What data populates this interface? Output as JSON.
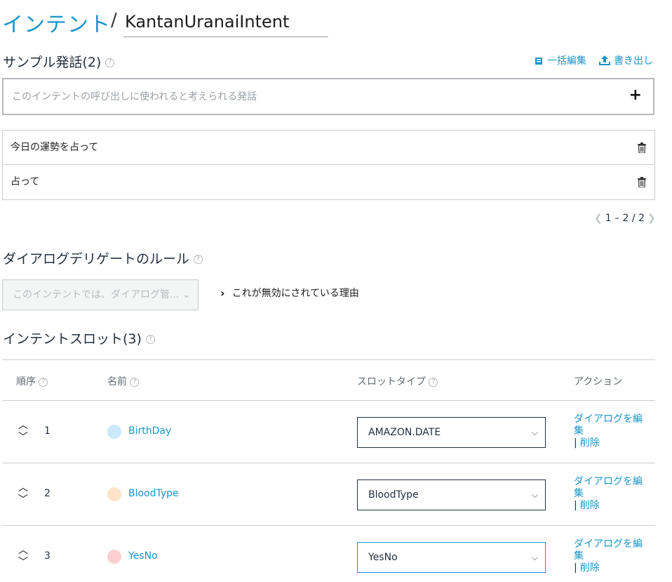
{
  "header": {
    "crumb": "インテント",
    "separator": "/",
    "intent_name": "KantanUranaiIntent"
  },
  "utterances": {
    "title": "サンプル発話(2)",
    "help": "?",
    "bulk_edit": "一括編集",
    "export": "書き出し",
    "placeholder": "このインテントの呼び出しに使われると考えられる発話",
    "add": "+",
    "items": [
      "今日の運勢を占って",
      "占って"
    ],
    "pager": "1 – 2 / 2"
  },
  "dialog": {
    "title": "ダイアログデリゲートのルール",
    "help": "?",
    "select_value": "このインテントでは、ダイアログ管...",
    "why_link": "これが無効にされている理由"
  },
  "slots": {
    "title": "インテントスロット(3)",
    "help": "?",
    "headers": {
      "order": "順序",
      "name": "名前",
      "type": "スロットタイプ",
      "actions": "アクション"
    },
    "rows": [
      {
        "order": "1",
        "name": "BirthDay",
        "type": "AMAZON.DATE",
        "dot_color": "#cce9fb",
        "focused": false,
        "edit": "ダイアログを編集",
        "sep": "|",
        "delete": "削除"
      },
      {
        "order": "2",
        "name": "BloodType",
        "type": "BloodType",
        "dot_color": "#fde3c8",
        "focused": false,
        "edit": "ダイアログを編集",
        "sep": "|",
        "delete": "削除"
      },
      {
        "order": "3",
        "name": "YesNo",
        "type": "YesNo",
        "dot_color": "#fcd0d0",
        "focused": true,
        "edit": "ダイアログを編集",
        "sep": "|",
        "delete": "削除"
      }
    ]
  },
  "colors": {
    "link": "#1b95c8",
    "text": "#232f3e",
    "border": "#c9ccce"
  }
}
